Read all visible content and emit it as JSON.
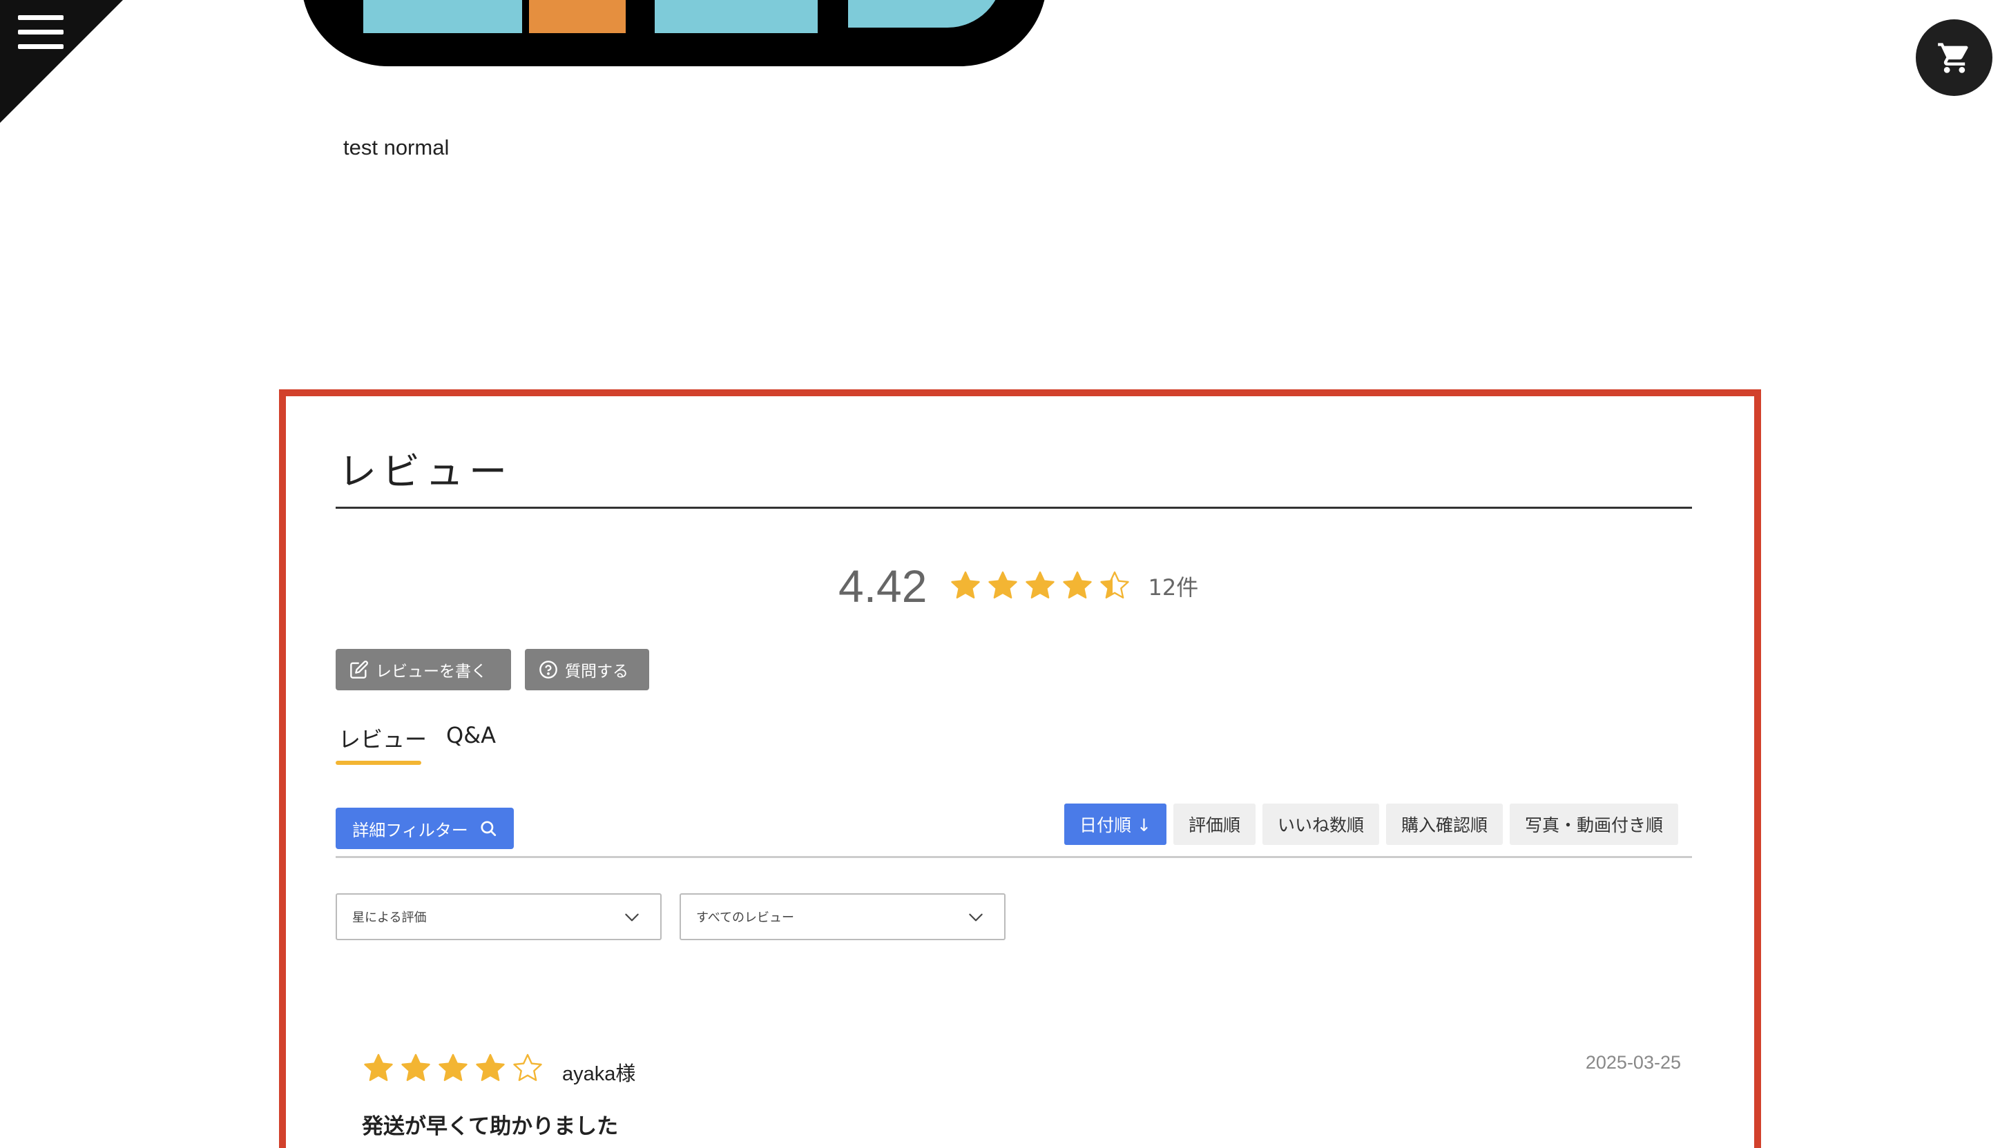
{
  "nav": {
    "menu_icon": "hamburger-menu-icon",
    "cart_icon": "shopping-cart-icon"
  },
  "product": {
    "name": "test normal"
  },
  "reviews": {
    "title": "レビュー",
    "average": "4.42",
    "average_rating": 4.42,
    "count_label": "12件",
    "write_button": "レビューを書く",
    "ask_button": "質問する",
    "tabs": [
      {
        "label": "レビュー",
        "active": true
      },
      {
        "label": "Q&A",
        "active": false
      }
    ],
    "filter_button": "詳細フィルター",
    "sort_options": [
      {
        "label": "日付順 ↓",
        "active": true
      },
      {
        "label": "評価順",
        "active": false
      },
      {
        "label": "いいね数順",
        "active": false
      },
      {
        "label": "購入確認順",
        "active": false
      },
      {
        "label": "写真・動画付き順",
        "active": false
      }
    ],
    "star_select": {
      "value": "星による評価"
    },
    "review_select": {
      "value": "すべてのレビュー"
    },
    "items": [
      {
        "rating": 4,
        "reviewer": "ayaka様",
        "date": "2025-03-25",
        "headline": "発送が早くて助かりました"
      }
    ]
  },
  "colors": {
    "accent_border": "#d2412c",
    "star": "#f3b533",
    "primary_blue": "#4a7be8",
    "gray_button": "#808080"
  }
}
